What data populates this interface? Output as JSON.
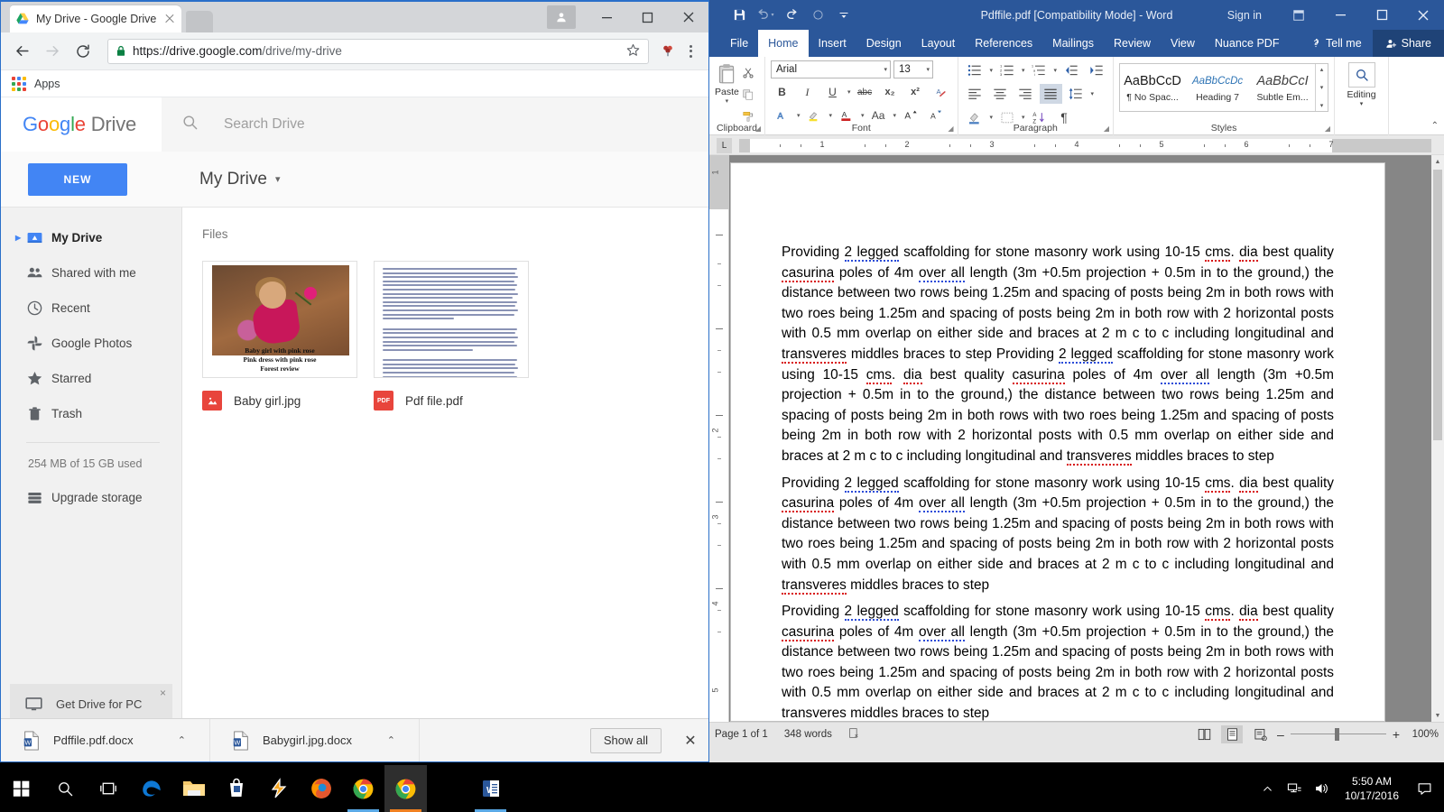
{
  "chrome": {
    "tab": {
      "title": "My Drive - Google Drive",
      "favicon": "drive-icon",
      "close": "×"
    },
    "window_controls": {
      "minimize": "–",
      "maximize": "☐",
      "close": "✕",
      "profile": "person-icon"
    },
    "toolbar": {
      "back": "←",
      "forward": "→",
      "reload": "⟳",
      "url_secure": "https://drive.google.com",
      "url_path": "/drive/my-drive",
      "lock": "lock-icon",
      "star": "☆",
      "extension": "extension-icon",
      "menu": "three-dot-menu"
    },
    "bookmarks": {
      "apps_label": "Apps"
    }
  },
  "drive": {
    "logo": {
      "g1": "G",
      "o1": "o",
      "o2": "o",
      "g2": "g",
      "l": "l",
      "e": "e",
      "product": "Drive"
    },
    "search": {
      "placeholder": "Search Drive",
      "icon": "search-icon"
    },
    "new_button": "NEW",
    "breadcrumb": "My Drive",
    "breadcrumb_caret": "▾",
    "sidebar": {
      "items": [
        {
          "label": "My Drive",
          "icon": "drive-icon",
          "active": true
        },
        {
          "label": "Shared with me",
          "icon": "people-icon",
          "active": false
        },
        {
          "label": "Recent",
          "icon": "clock-icon",
          "active": false
        },
        {
          "label": "Google Photos",
          "icon": "photos-pinwheel-icon",
          "active": false
        },
        {
          "label": "Starred",
          "icon": "star-icon",
          "active": false
        },
        {
          "label": "Trash",
          "icon": "trash-icon",
          "active": false
        }
      ],
      "storage": "254 MB of 15 GB used",
      "upgrade": "Upgrade storage",
      "upgrade_icon": "storage-bars-icon",
      "get_drive": "Get Drive for PC",
      "get_drive_icon": "monitor-icon",
      "get_drive_close": "×"
    },
    "main": {
      "section_label": "Files",
      "files": [
        {
          "name": "Baby girl.jpg",
          "icon": "image-file-icon",
          "icon_label": "IMG",
          "thumb_type": "photo",
          "caption_lines": [
            "Baby girl with pink rose",
            "Pink dress with pink rose",
            "Forest review"
          ]
        },
        {
          "name": "Pdf file.pdf",
          "icon": "pdf-file-icon",
          "icon_label": "PDF",
          "thumb_type": "document",
          "caption_lines": []
        }
      ]
    }
  },
  "downloads": {
    "items": [
      {
        "name": "Pdffile.pdf.docx",
        "icon": "word-doc-icon",
        "caret": "⌃"
      },
      {
        "name": "Babygirl.jpg.docx",
        "icon": "word-doc-icon",
        "caret": "⌃"
      }
    ],
    "show_all": "Show all",
    "close": "✕"
  },
  "word": {
    "title": "Pdffile.pdf [Compatibility Mode] - Word",
    "sign_in": "Sign in",
    "quick_access": [
      {
        "name": "save-icon",
        "glyph": "💾"
      },
      {
        "name": "undo-icon",
        "glyph": "↶"
      },
      {
        "name": "redo-icon",
        "glyph": "↷"
      },
      {
        "name": "repeat-icon",
        "glyph": "○"
      },
      {
        "name": "customize-qat-icon",
        "glyph": "▾"
      }
    ],
    "window_controls": {
      "ribbon_display": "⊞",
      "minimize": "–",
      "maximize": "☐",
      "close": "✕"
    },
    "tabs": [
      "File",
      "Home",
      "Insert",
      "Design",
      "Layout",
      "References",
      "Mailings",
      "Review",
      "View",
      "Nuance PDF"
    ],
    "active_tab": "Home",
    "tell_me": "Tell me",
    "share": "Share",
    "ribbon": {
      "clipboard": {
        "label": "Clipboard",
        "paste": "Paste",
        "cut": "cut-icon",
        "copy": "copy-icon",
        "format_painter": "format-painter-icon"
      },
      "font": {
        "label": "Font",
        "font_name": "Arial",
        "font_size": "13",
        "bold": "B",
        "italic": "I",
        "underline": "U",
        "strikethrough": "abc",
        "subscript": "x₂",
        "superscript": "x²",
        "clear_formatting": "clear-formatting-icon",
        "text_effects": "A",
        "highlight": "highlight-icon",
        "font_color": "A",
        "change_case": "Aa",
        "grow_font": "A˄",
        "shrink_font": "A˅"
      },
      "paragraph": {
        "label": "Paragraph",
        "bullets": "bullet-list-icon",
        "numbering": "numbered-list-icon",
        "multilevel": "multilevel-list-icon",
        "decrease_indent": "decrease-indent-icon",
        "increase_indent": "increase-indent-icon",
        "align_left": "align-left-icon",
        "align_center": "align-center-icon",
        "align_right": "align-right-icon",
        "justify": "justify-icon",
        "line_spacing": "line-spacing-icon",
        "shading": "shading-icon",
        "borders": "borders-icon",
        "sort": "sort-icon",
        "show_marks": "¶"
      },
      "styles": {
        "label": "Styles",
        "gallery": [
          {
            "preview": "AaBbCcD",
            "name": "¶ No Spac..."
          },
          {
            "preview": "AaBbCcDc",
            "name": "Heading 7"
          },
          {
            "preview": "AaBbCcI",
            "name": "Subtle Em..."
          }
        ]
      },
      "editing": {
        "label": "Editing",
        "icon": "magnifier-icon",
        "caret": "▾"
      },
      "collapse": "⌃"
    },
    "ruler": {
      "tab_selector": "L",
      "numbers": [
        "1",
        "2",
        "3",
        "4",
        "5",
        "6",
        "7"
      ],
      "vertical_numbers": [
        "1",
        "2",
        "3",
        "4",
        "5"
      ]
    },
    "document": {
      "paragraphs": [
        "Providing 2 legged scaffolding for stone masonry work using 10-15 cms. dia best quality casurina poles of 4m over all length (3m +0.5m projection + 0.5m in to the ground,) the distance between two rows being 1.25m and spacing of posts being 2m in both rows with two roes being 1.25m and spacing of posts being 2m in both row with 2 horizontal posts with 0.5 mm overlap on either side and braces at 2 m c to c including longitudinal and transveres middles braces to step Providing 2 legged scaffolding for stone masonry work using 10-15 cms. dia best quality casurina poles of 4m over all length (3m +0.5m projection + 0.5m in to the ground,) the distance between two rows being 1.25m and spacing of posts being 2m in both rows with two roes being 1.25m and spacing of posts being 2m in both row with 2 horizontal posts with 0.5 mm overlap on either side and braces at 2 m c to c including longitudinal and transveres middles braces to step",
        "Providing 2 legged scaffolding for stone masonry work using 10-15 cms. dia best quality casurina poles of 4m over all length (3m +0.5m projection + 0.5m in to the ground,) the distance between two rows being 1.25m and spacing of posts being 2m in both rows with two roes being 1.25m and spacing of posts being 2m in both row with 2 horizontal posts with 0.5 mm overlap on either side and braces at 2 m c to c including longitudinal and transveres middles braces to step",
        "Providing 2 legged scaffolding for stone masonry work using 10-15 cms. dia best quality casurina poles of 4m over all length (3m +0.5m projection + 0.5m in to the ground,) the distance between two rows being 1.25m and spacing of posts being 2m in both rows with two roes being 1.25m and spacing of posts being 2m in both row with 2 horizontal posts with 0.5 mm overlap on either side and braces at 2 m c to c including longitudinal and transveres middles braces to step"
      ]
    },
    "status": {
      "page": "Page 1 of 1",
      "words": "348 words",
      "proofing_icon": "proofing-errors-icon",
      "view_read": "read-mode-icon",
      "view_print": "print-layout-icon",
      "view_web": "web-layout-icon",
      "zoom_out": "–",
      "zoom_in": "+",
      "zoom": "100%"
    }
  },
  "taskbar": {
    "start": "windows-start-icon",
    "search": "search-icon",
    "task_view": "task-view-icon",
    "apps": [
      {
        "name": "edge-icon",
        "running": false,
        "underline": ""
      },
      {
        "name": "file-explorer-icon",
        "running": false,
        "underline": ""
      },
      {
        "name": "microsoft-store-icon",
        "running": false,
        "underline": ""
      },
      {
        "name": "winamp-icon",
        "running": false,
        "underline": ""
      },
      {
        "name": "firefox-icon",
        "running": false,
        "underline": ""
      },
      {
        "name": "chrome-icon",
        "running": true,
        "underline": "#5aa9e6"
      },
      {
        "name": "chrome-active-icon",
        "running": true,
        "underline": "#f08020"
      },
      {
        "name": "word-icon",
        "running": true,
        "underline": "#5aa9e6"
      }
    ],
    "tray": {
      "show_hidden": "⌃",
      "network": "network-icon",
      "volume": "volume-icon",
      "time": "5:50 AM",
      "date": "10/17/2016",
      "action_center": "action-center-icon"
    }
  }
}
